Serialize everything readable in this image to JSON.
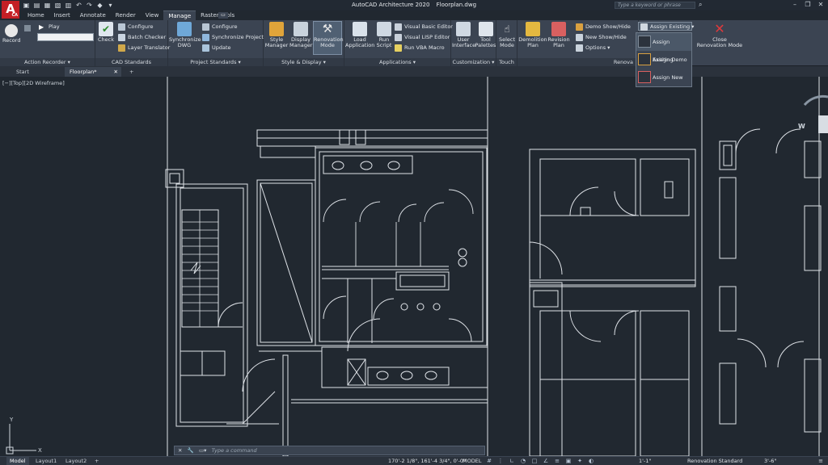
{
  "app": {
    "logo_letter": "A",
    "logo_sub": "CA",
    "title": "AutoCAD Architecture 2020",
    "filename": "Floorplan.dwg",
    "search_placeholder": "Type a keyword or phrase"
  },
  "ribbon_tabs": [
    "Home",
    "Insert",
    "Annotate",
    "Render",
    "View",
    "Manage",
    "Raster Tools"
  ],
  "active_tab": "Manage",
  "panels": {
    "action_recorder": {
      "title": "Action Recorder",
      "record": "Record",
      "play": "Play"
    },
    "cad_standards": {
      "title": "CAD Standards",
      "check": "Check",
      "configure": "Configure",
      "batch_checker": "Batch Checker",
      "layer_translator": "Layer Translator"
    },
    "project_standards": {
      "title": "Project Standards",
      "synchronize_dwg": "Synchronize\nDWG",
      "configure": "Configure",
      "synchronize_project": "Synchronize Project",
      "update": "Update"
    },
    "style_display": {
      "title": "Style & Display",
      "style_manager": "Style\nManager",
      "display_manager": "Display\nManager",
      "renovation_mode": "Renovation\nMode"
    },
    "applications": {
      "title": "Applications",
      "load_application": "Load\nApplication",
      "run_script": "Run\nScript",
      "vb_editor": "Visual Basic Editor",
      "lisp_editor": "Visual LISP Editor",
      "run_vba": "Run VBA Macro"
    },
    "customization": {
      "title": "Customization",
      "user_interface": "User\nInterface",
      "tool_palettes": "Tool\nPalettes"
    },
    "touch": {
      "title": "Touch",
      "select_mode": "Select\nMode"
    },
    "renovation": {
      "title": "Renova",
      "demolition_plan": "Demolition\nPlan",
      "revision_plan": "Revision\nPlan",
      "demo_show_hide": "Demo Show/Hide",
      "new_show_hide": "New Show/Hide",
      "options": "Options",
      "assign_existing": "Assign Existing",
      "close_renovation": "Close\nRenovation Mode"
    }
  },
  "dropdown": [
    "Assign Existing",
    "Assign Demo",
    "Assign New"
  ],
  "doc_tabs": [
    "Start",
    "Floorplan*",
    "+"
  ],
  "viewport_label": "[−][Top][2D Wireframe]",
  "command_placeholder": "Type a command",
  "layout_tabs": [
    "Model",
    "Layout1",
    "Layout2",
    "+"
  ],
  "status": {
    "coords": "170'-2 1/8\", 161'-4 3/4\", 0'-0\"",
    "model": "MODEL",
    "scale": "1'-1\"",
    "display_config": "Renovation Standard",
    "cut_plane": "3'-6\""
  },
  "viewcube": {
    "west": "W"
  },
  "colors": {
    "ribbon_bg": "#3b4452",
    "canvas_bg": "#212830",
    "logo_red": "#c41f25",
    "drawing_lines": "#dfe3e8"
  }
}
